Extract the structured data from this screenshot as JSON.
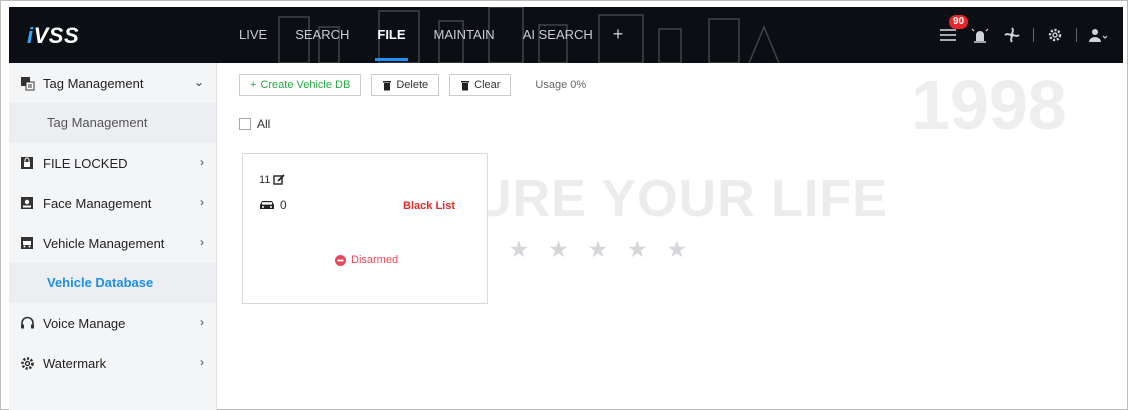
{
  "app": {
    "logo_prefix": "i",
    "logo_rest": "VSS"
  },
  "nav": {
    "tabs": [
      "LIVE",
      "SEARCH",
      "FILE",
      "MAINTAIN",
      "AI SEARCH"
    ],
    "active": "FILE",
    "plus": "+"
  },
  "header": {
    "alarm_count": "90"
  },
  "sidebar": {
    "items": [
      {
        "label": "Tag Management",
        "arrow": "⌄"
      },
      {
        "label": "Tag Management"
      },
      {
        "label": "FILE LOCKED",
        "arrow": "›"
      },
      {
        "label": "Face Management",
        "arrow": "›"
      },
      {
        "label": "Vehicle Management",
        "arrow": "›"
      },
      {
        "label": "Vehicle Database"
      },
      {
        "label": "Voice Manage",
        "arrow": "›"
      },
      {
        "label": "Watermark",
        "arrow": "›"
      }
    ]
  },
  "toolbar": {
    "create_label": "Create Vehicle DB",
    "delete_label": "Delete",
    "clear_label": "Clear",
    "usage": "Usage 0%"
  },
  "list": {
    "all_label": "All"
  },
  "card": {
    "id": "11",
    "vehicle_count": "0",
    "list_type": "Black List",
    "status": "Disarmed"
  },
  "watermark": {
    "slogan": "WE SECURE YOUR LIFE",
    "year": "1998",
    "stars": "★ ★ ★ ★ ★ ★ ★"
  },
  "colors": {
    "accent": "#1e90ff",
    "alarm": "#e8262d",
    "create": "#27a844",
    "blacklist": "#e02a2a",
    "disarmed": "#e8495a"
  }
}
